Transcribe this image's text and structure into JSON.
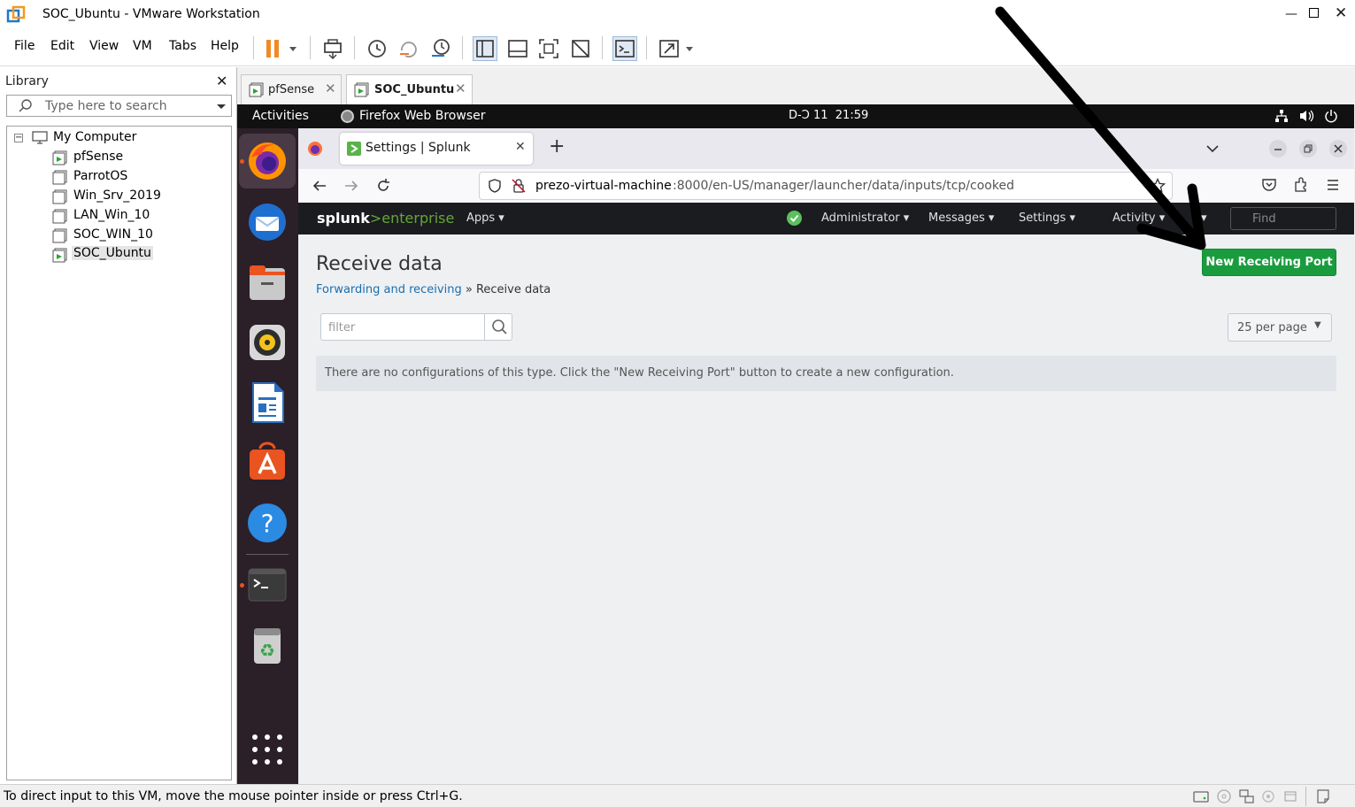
{
  "window": {
    "title": "SOC_Ubuntu - VMware Workstation",
    "menu": [
      "File",
      "Edit",
      "View",
      "VM",
      "Tabs",
      "Help"
    ]
  },
  "library": {
    "header": "Library",
    "search_placeholder": "Type here to search",
    "root": "My Computer",
    "items": [
      "pfSense",
      "ParrotOS",
      "Win_Srv_2019",
      "LAN_Win_10",
      "SOC_WIN_10",
      "SOC_Ubuntu"
    ]
  },
  "vm_tabs": [
    {
      "label": "pfSense"
    },
    {
      "label": "SOC_Ubuntu"
    }
  ],
  "ubuntu": {
    "activities": "Activities",
    "app_name": "Firefox Web Browser",
    "clock": "D-Ɔ 11  21:59"
  },
  "firefox": {
    "tab_title": "Settings | Splunk",
    "url_host": "prezo-virtual-machine",
    "url_path": ":8000/en-US/manager/launcher/data/inputs/tcp/cooked"
  },
  "splunk": {
    "logo_a": "splunk",
    "logo_b": ">enterprise",
    "apps": "Apps",
    "menus": [
      "Administrator",
      "Messages",
      "Settings",
      "Activity"
    ],
    "find_placeholder": "Find",
    "page_title": "Receive data",
    "breadcrumb_link": "Forwarding and receiving",
    "breadcrumb_sep": " » ",
    "breadcrumb_current": "Receive data",
    "new_button": "New Receiving Port",
    "filter_placeholder": "filter",
    "per_page": "25 per page",
    "empty_message": "There are no configurations of this type. Click the \"New Receiving Port\" button to create a new configuration."
  },
  "statusbar": {
    "text": "To direct input to this VM, move the mouse pointer inside or press Ctrl+G."
  },
  "colors": {
    "splunk_green": "#1a9c3e",
    "ubuntu_dock": "#2b1f28",
    "pause_orange": "#f08a24"
  }
}
